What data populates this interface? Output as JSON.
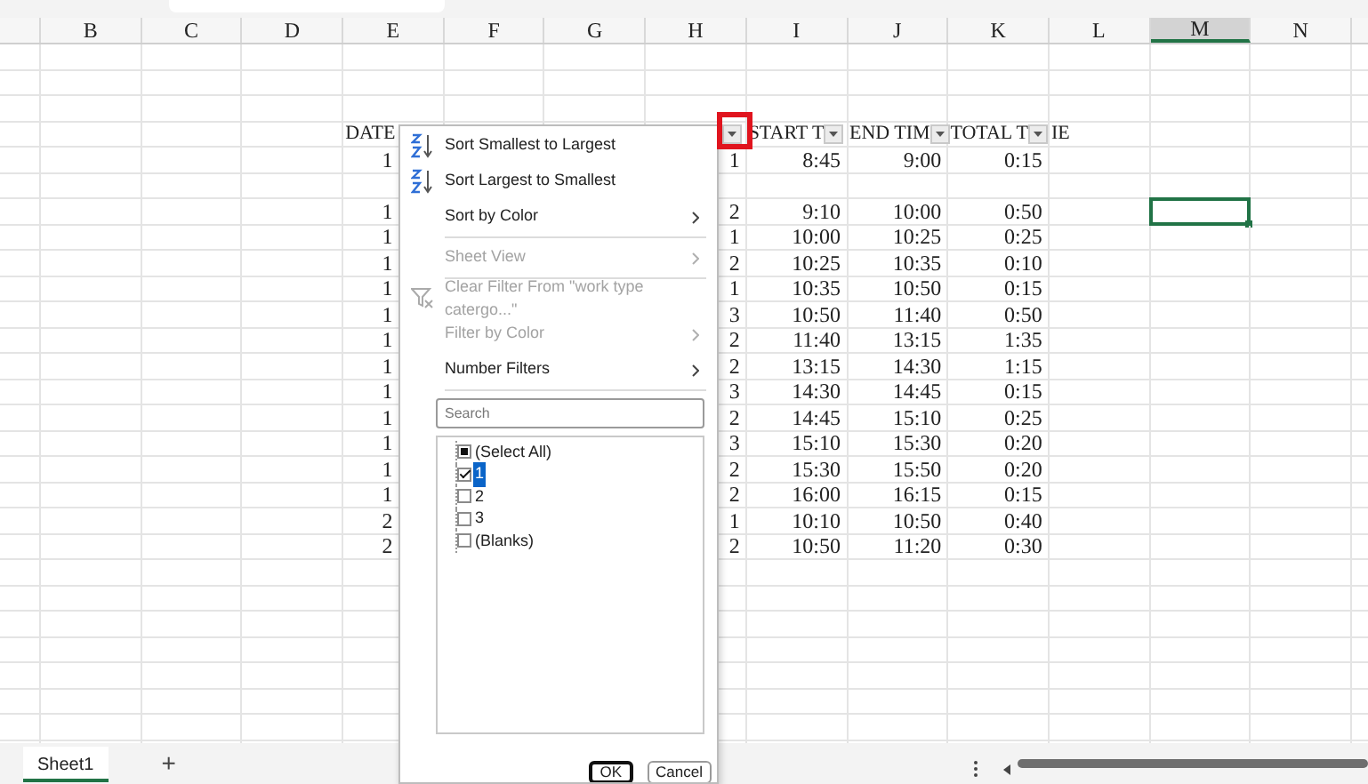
{
  "column_headers": [
    {
      "label": "B",
      "selected": false
    },
    {
      "label": "C",
      "selected": false
    },
    {
      "label": "D",
      "selected": false
    },
    {
      "label": "E",
      "selected": false
    },
    {
      "label": "F",
      "selected": false
    },
    {
      "label": "G",
      "selected": false
    },
    {
      "label": "H",
      "selected": false
    },
    {
      "label": "I",
      "selected": false
    },
    {
      "label": "J",
      "selected": false
    },
    {
      "label": "K",
      "selected": false
    },
    {
      "label": "L",
      "selected": false
    },
    {
      "label": "M",
      "selected": true
    },
    {
      "label": "N",
      "selected": false
    }
  ],
  "table": {
    "header": {
      "date": {
        "text": "DATE"
      },
      "work_type": {
        "filter": true,
        "annotated": true
      },
      "start": {
        "text": "START T",
        "filter": true
      },
      "end": {
        "text": "END TIM",
        "filter": true
      },
      "total": {
        "text": "TOTAL T",
        "after": "IE",
        "filter": true
      }
    },
    "rows": [
      {
        "kind": "data",
        "selected": false,
        "date": "1",
        "work_type": "1",
        "start": "8:45",
        "end": "9:00",
        "total": "0:15"
      },
      {
        "kind": "blank",
        "selected": false
      },
      {
        "kind": "data",
        "selected": true,
        "date": "1",
        "work_type": "2",
        "start": "9:10",
        "end": "10:00",
        "total": "0:50"
      },
      {
        "kind": "data",
        "selected": false,
        "date": "1",
        "work_type": "1",
        "start": "10:00",
        "end": "10:25",
        "total": "0:25"
      },
      {
        "kind": "data",
        "selected": false,
        "date": "1",
        "work_type": "2",
        "start": "10:25",
        "end": "10:35",
        "total": "0:10"
      },
      {
        "kind": "data",
        "selected": false,
        "date": "1",
        "work_type": "1",
        "start": "10:35",
        "end": "10:50",
        "total": "0:15"
      },
      {
        "kind": "data",
        "selected": false,
        "date": "1",
        "work_type": "3",
        "start": "10:50",
        "end": "11:40",
        "total": "0:50"
      },
      {
        "kind": "data",
        "selected": false,
        "date": "1",
        "work_type": "2",
        "start": "11:40",
        "end": "13:15",
        "total": "1:35"
      },
      {
        "kind": "data",
        "selected": false,
        "date": "1",
        "work_type": "2",
        "start": "13:15",
        "end": "14:30",
        "total": "1:15"
      },
      {
        "kind": "data",
        "selected": false,
        "date": "1",
        "work_type": "3",
        "start": "14:30",
        "end": "14:45",
        "total": "0:15"
      },
      {
        "kind": "data",
        "selected": false,
        "date": "1",
        "work_type": "2",
        "start": "14:45",
        "end": "15:10",
        "total": "0:25"
      },
      {
        "kind": "data",
        "selected": false,
        "date": "1",
        "work_type": "3",
        "start": "15:10",
        "end": "15:30",
        "total": "0:20"
      },
      {
        "kind": "data",
        "selected": false,
        "date": "1",
        "work_type": "2",
        "start": "15:30",
        "end": "15:50",
        "total": "0:20"
      },
      {
        "kind": "data",
        "selected": false,
        "date": "1",
        "work_type": "2",
        "start": "16:00",
        "end": "16:15",
        "total": "0:15"
      },
      {
        "kind": "data",
        "selected": false,
        "date": "2",
        "work_type": "1",
        "start": "10:10",
        "end": "10:50",
        "total": "0:40"
      },
      {
        "kind": "data",
        "selected": false,
        "date": "2",
        "work_type": "2",
        "start": "10:50",
        "end": "11:20",
        "total": "0:30"
      }
    ]
  },
  "filter_menu": {
    "items": [
      {
        "kind": "sort_ascending",
        "label": "Sort Smallest to Largest",
        "disabled": false,
        "submenu": false
      },
      {
        "kind": "sort_descending",
        "label": "Sort Largest to Smallest",
        "disabled": false,
        "submenu": false
      },
      {
        "kind": "item",
        "label": "Sort by Color",
        "disabled": false,
        "submenu": true
      },
      {
        "kind": "separator"
      },
      {
        "kind": "item",
        "label": "Sheet View",
        "disabled": true,
        "submenu": true
      },
      {
        "kind": "separator"
      },
      {
        "kind": "clear_filter",
        "label": "Clear Filter From \"work type catergo...\"",
        "disabled": true,
        "submenu": false
      },
      {
        "kind": "item",
        "label": "Filter by Color",
        "disabled": true,
        "submenu": true
      },
      {
        "kind": "item",
        "label": "Number Filters",
        "disabled": false,
        "submenu": true
      },
      {
        "kind": "separator"
      }
    ],
    "search": {
      "placeholder": "Search"
    },
    "values": [
      {
        "label": "(Select All)",
        "checked": false,
        "indeterminate": true,
        "selected": false
      },
      {
        "label": "1",
        "checked": true,
        "indeterminate": false,
        "selected": true
      },
      {
        "label": "2",
        "checked": false,
        "indeterminate": false,
        "selected": false
      },
      {
        "label": "3",
        "checked": false,
        "indeterminate": false,
        "selected": false
      },
      {
        "label": "(Blanks)",
        "checked": false,
        "indeterminate": false,
        "selected": false
      }
    ],
    "buttons": [
      {
        "label": "OK",
        "focused": true
      },
      {
        "label": "Cancel",
        "focused": false
      }
    ]
  },
  "sheet_tabs": [
    {
      "label": "Sheet1",
      "selected": true
    }
  ],
  "add_sheet": "+"
}
